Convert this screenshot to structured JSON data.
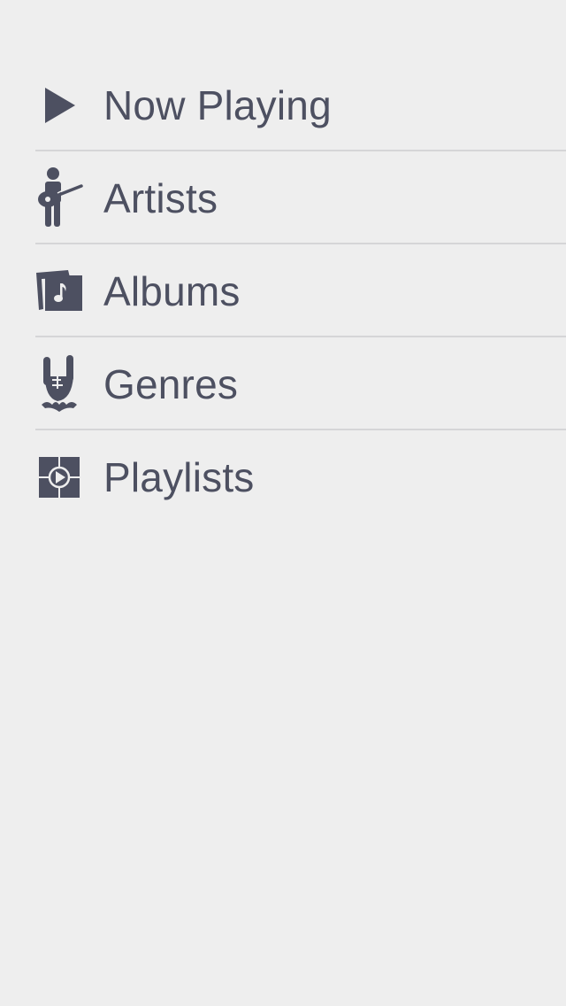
{
  "menu": {
    "items": [
      {
        "label": "Now Playing",
        "icon": "play-icon"
      },
      {
        "label": "Artists",
        "icon": "guitarist-icon"
      },
      {
        "label": "Albums",
        "icon": "albums-music-note-icon"
      },
      {
        "label": "Genres",
        "icon": "rock-hand-icon"
      },
      {
        "label": "Playlists",
        "icon": "playlist-icon"
      }
    ]
  },
  "colors": {
    "background": "#eeeeee",
    "text": "#4d5061",
    "icon": "#4d5061",
    "divider": "#d5d5d7"
  }
}
